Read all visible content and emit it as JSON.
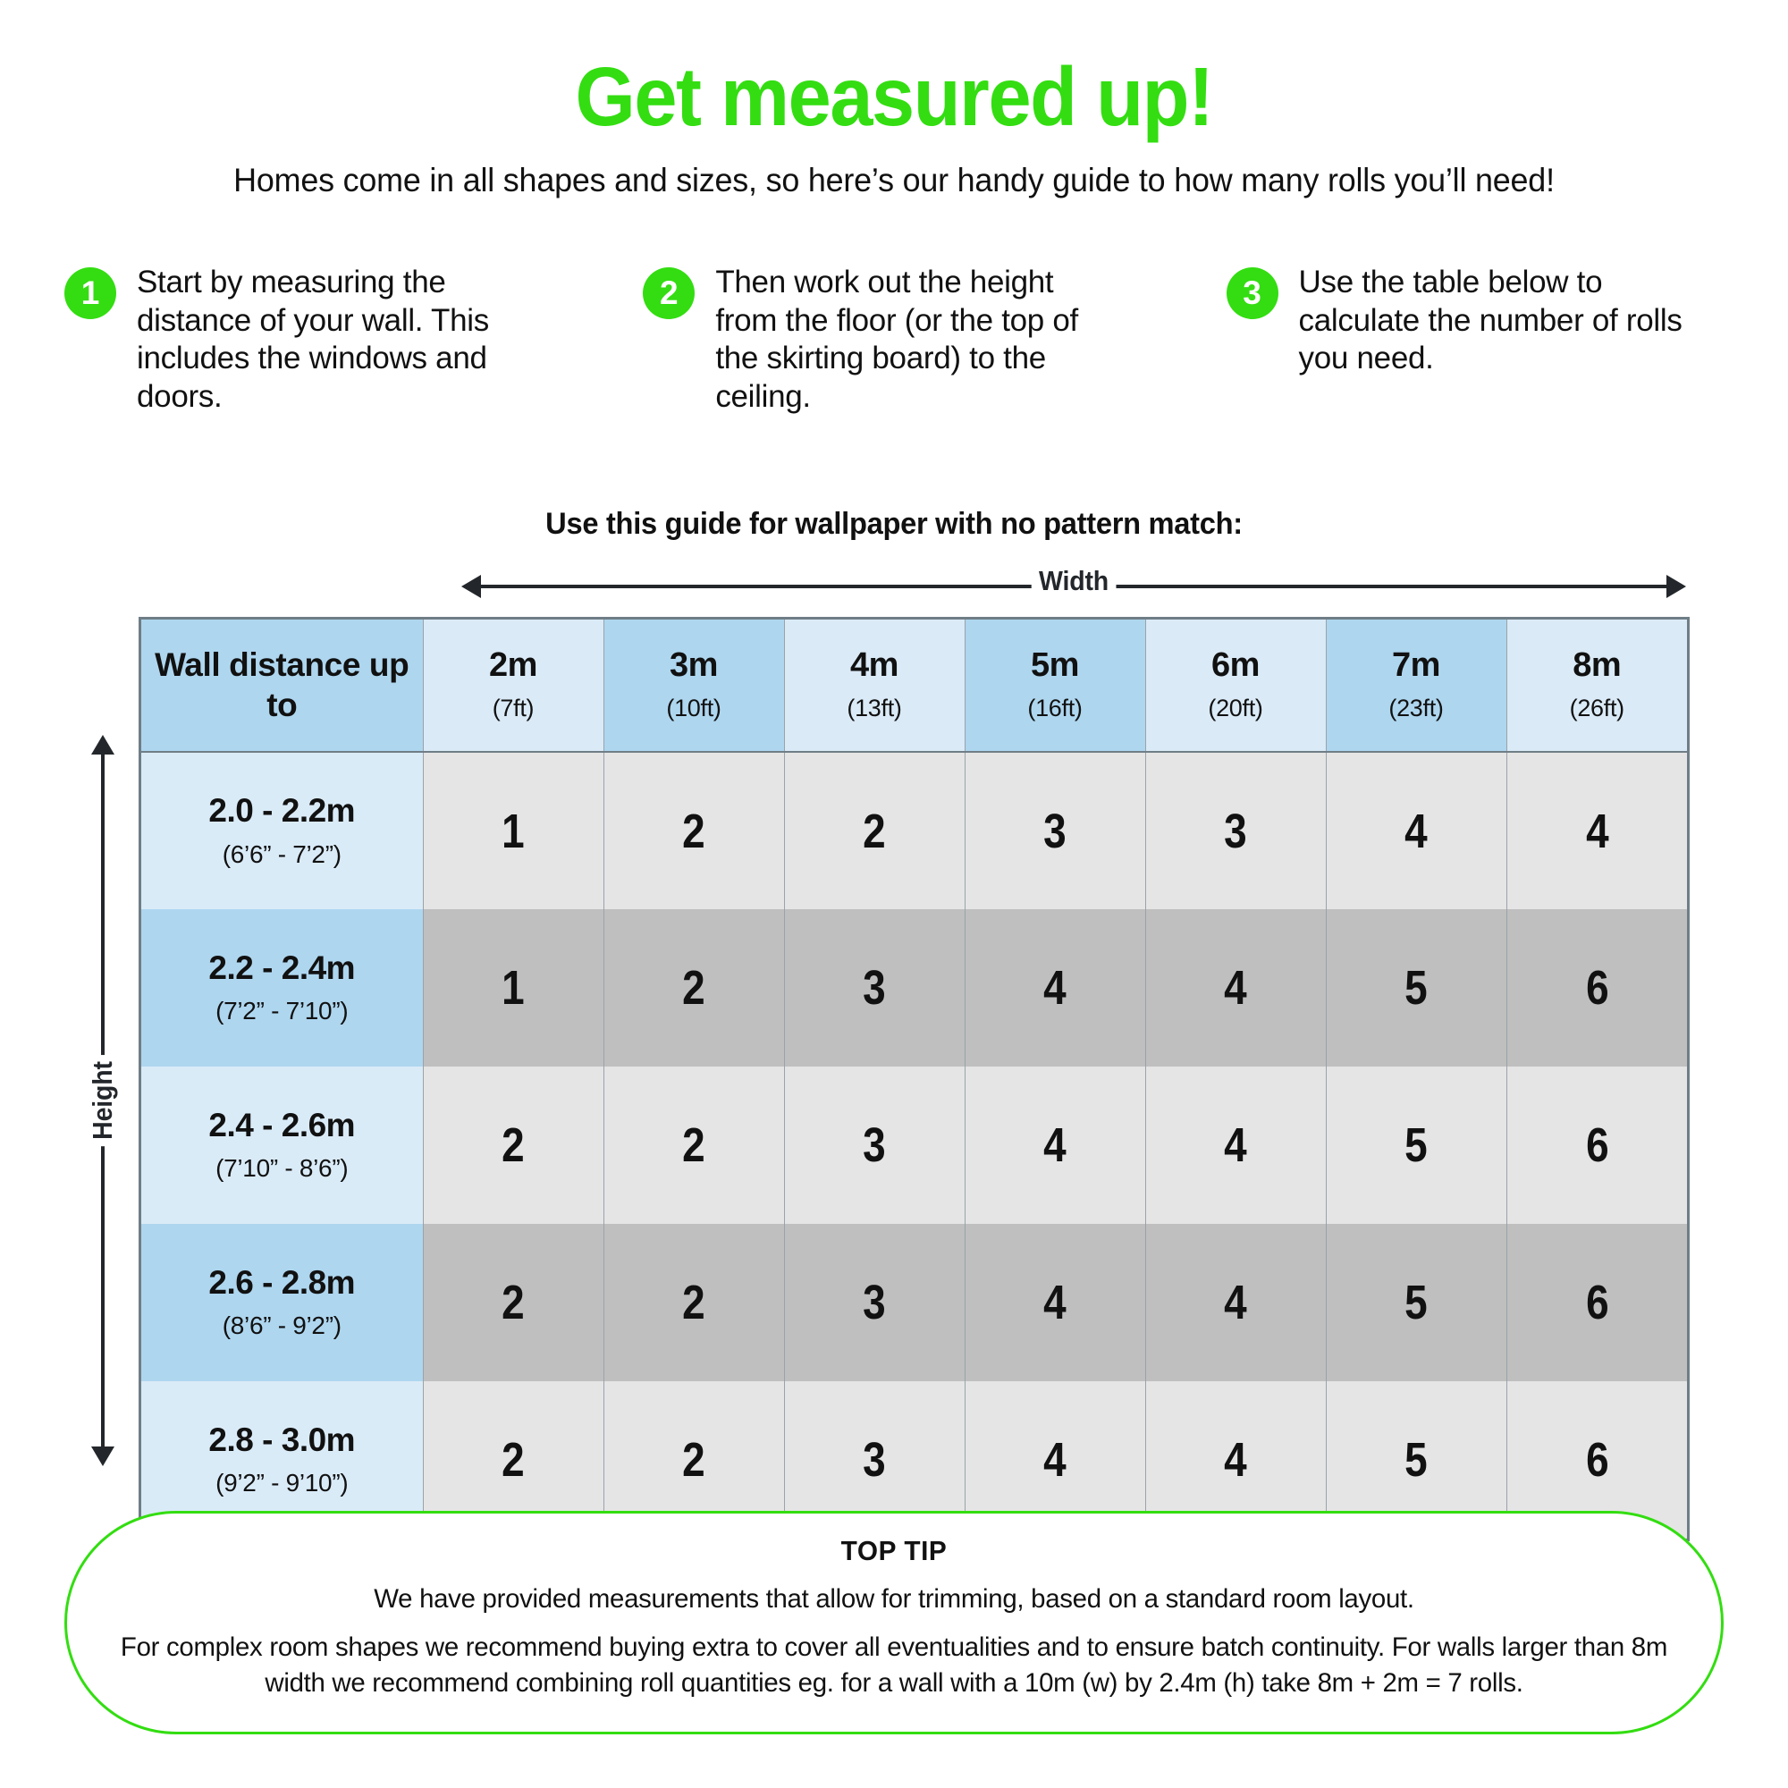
{
  "header": {
    "title": "Get measured up!",
    "subtitle": "Homes come in all shapes and sizes, so here’s our handy guide to how many rolls you’ll need!",
    "title_color": "#33dd11"
  },
  "steps": [
    {
      "number": "1",
      "text": "Start by measuring the distance of your wall. This includes the windows and doors."
    },
    {
      "number": "2",
      "text": "Then work out the height from the floor (or the top of the skirting board) to the ceiling."
    },
    {
      "number": "3",
      "text": "Use the table below to calculate the number of rolls you need."
    }
  ],
  "guide_note": "Use this guide for wallpaper with no pattern match:",
  "axes": {
    "width_label": "Width",
    "height_label": "Height"
  },
  "table": {
    "corner_label": "Wall distance up to",
    "columns": [
      {
        "m": "2m",
        "ft": "(7ft)",
        "shade": "light"
      },
      {
        "m": "3m",
        "ft": "(10ft)",
        "shade": "mid"
      },
      {
        "m": "4m",
        "ft": "(13ft)",
        "shade": "light"
      },
      {
        "m": "5m",
        "ft": "(16ft)",
        "shade": "mid"
      },
      {
        "m": "6m",
        "ft": "(20ft)",
        "shade": "light"
      },
      {
        "m": "7m",
        "ft": "(23ft)",
        "shade": "mid"
      },
      {
        "m": "8m",
        "ft": "(26ft)",
        "shade": "light"
      }
    ],
    "rows": [
      {
        "m": "2.0 - 2.2m",
        "ft": "(6’6” - 7’2”)",
        "label_shade": "light",
        "cell_shade": "light",
        "values": [
          "1",
          "2",
          "2",
          "3",
          "3",
          "4",
          "4"
        ]
      },
      {
        "m": "2.2 - 2.4m",
        "ft": "(7’2” - 7’10”)",
        "label_shade": "mid",
        "cell_shade": "dark",
        "values": [
          "1",
          "2",
          "3",
          "4",
          "4",
          "5",
          "6"
        ]
      },
      {
        "m": "2.4 - 2.6m",
        "ft": "(7’10” - 8’6”)",
        "label_shade": "light",
        "cell_shade": "light",
        "values": [
          "2",
          "2",
          "3",
          "4",
          "4",
          "5",
          "6"
        ]
      },
      {
        "m": "2.6 - 2.8m",
        "ft": "(8’6” - 9’2”)",
        "label_shade": "mid",
        "cell_shade": "dark",
        "values": [
          "2",
          "2",
          "3",
          "4",
          "4",
          "5",
          "6"
        ]
      },
      {
        "m": "2.8 - 3.0m",
        "ft": "(9’2” - 9’10”)",
        "label_shade": "light",
        "cell_shade": "light",
        "values": [
          "2",
          "2",
          "3",
          "4",
          "4",
          "5",
          "6"
        ]
      }
    ]
  },
  "tip": {
    "title": "TOP TIP",
    "line1": "We have provided measurements that allow for trimming, based on a standard room layout.",
    "line2": "For complex room shapes we recommend buying extra to cover all eventualities and to ensure batch continuity. For walls larger than 8m width we recommend combining roll quantities eg. for a wall with a 10m (w) by 2.4m (h) take 8m + 2m = 7 rolls.",
    "border_color": "#33dd11"
  },
  "colors": {
    "green": "#33dd11",
    "blue_mid": "#aed6ef",
    "blue_light": "#daeaf7",
    "gray_light": "#e5e5e5",
    "gray_dark": "#bfbfbf",
    "table_border": "#6f7d86"
  }
}
